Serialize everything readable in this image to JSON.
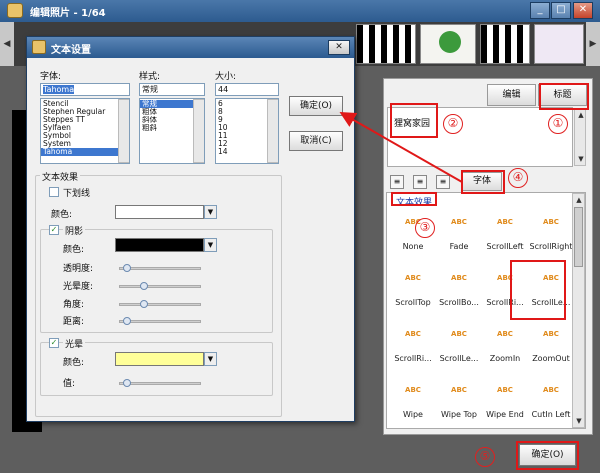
{
  "window": {
    "title": "编辑照片 - 1/64",
    "minimize": "_",
    "maximize": "□",
    "close": "✕"
  },
  "filmstrip": {
    "prev": "◀",
    "next": "▶"
  },
  "tabs": {
    "edit": "编辑",
    "title": "标题"
  },
  "text_content": "狸窝家园",
  "font_button": "字体",
  "effects": {
    "legend": "文本效果",
    "items": [
      "None",
      "Fade",
      "ScrollLeft",
      "ScrollRight",
      "ScrollTop",
      "ScrollBo...",
      "ScrollRi...",
      "ScrollLe...",
      "ScrollRi...",
      "ScrollLe...",
      "ZoomIn",
      "ZoomOut",
      "Wipe",
      "Wipe Top",
      "Wipe End",
      "CutIn Left"
    ],
    "thumb_label": "ABC"
  },
  "ok_button": "确定(O)",
  "annotations": [
    "①",
    "②",
    "③",
    "④",
    "⑤"
  ],
  "dialog": {
    "title": "文本设置",
    "close": "✕",
    "font_label": "字体:",
    "style_label": "样式:",
    "size_label": "大小:",
    "font_value": "Tahoma",
    "style_value": "常规",
    "size_value": "44",
    "fonts": [
      "Stencil",
      "Stephen Regular",
      "Steppes TT",
      "Sylfaen",
      "Symbol",
      "System",
      "Tahoma"
    ],
    "styles": [
      "常规",
      "粗体",
      "斜体",
      "粗斜"
    ],
    "sizes": [
      "6",
      "8",
      "9",
      "10",
      "11",
      "12",
      "14"
    ],
    "ok": "确定(O)",
    "cancel": "取消(C)",
    "effects_label": "文本效果",
    "underline": "下划线",
    "color_label": "颜色:",
    "shadow_label": "阴影",
    "shadow_color_label": "颜色:",
    "opacity_label": "透明度:",
    "blur_label": "光晕度:",
    "angle_label": "角度:",
    "distance_label": "距离:",
    "glow_label": "光晕",
    "glow_color_label": "颜色:",
    "glow_value_label": "值:",
    "text_color": "#ffffff",
    "shadow_color": "#000000",
    "glow_color": "#ffff99",
    "sliders": {
      "opacity": 0.05,
      "blur": 0.28,
      "angle": 0.28,
      "distance": 0.05,
      "glow_value": 0.05
    }
  },
  "colors": {
    "annotation_red": "#e01818",
    "selection": "#3d77cf"
  }
}
